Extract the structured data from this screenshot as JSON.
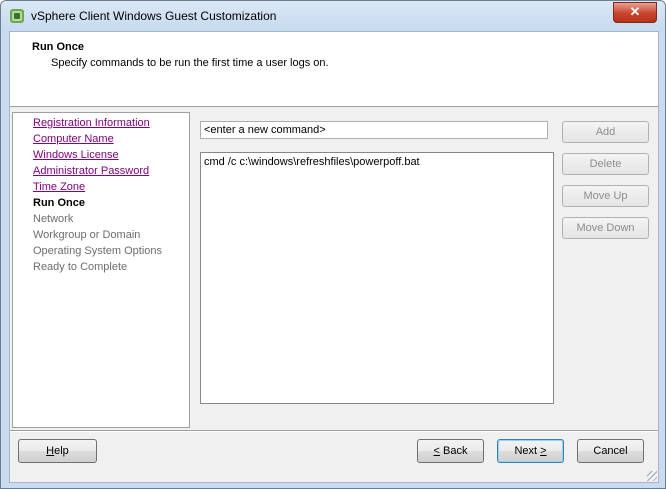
{
  "window": {
    "title": "vSphere Client Windows Guest Customization",
    "close_label": "✕"
  },
  "header": {
    "title": "Run Once",
    "subtitle": "Specify commands to be run the first time a user logs on."
  },
  "nav": {
    "items": [
      {
        "label": "Registration Information",
        "state": "link"
      },
      {
        "label": "Computer Name",
        "state": "link"
      },
      {
        "label": "Windows License",
        "state": "link"
      },
      {
        "label": "Administrator Password",
        "state": "link"
      },
      {
        "label": "Time Zone",
        "state": "link"
      },
      {
        "label": "Run Once",
        "state": "current"
      },
      {
        "label": "Network",
        "state": "disabled"
      },
      {
        "label": "Workgroup or Domain",
        "state": "disabled"
      },
      {
        "label": "Operating System Options",
        "state": "disabled"
      },
      {
        "label": "Ready to Complete",
        "state": "disabled"
      }
    ]
  },
  "command": {
    "new_value": "<enter a new command>",
    "list": [
      "cmd /c c:\\windows\\refreshfiles\\powerpoff.bat"
    ]
  },
  "side_buttons": {
    "add": "Add",
    "delete": "Delete",
    "move_up": "Move Up",
    "move_down": "Move Down"
  },
  "footer": {
    "help_mnemonic": "H",
    "help_rest": "elp",
    "back_mnemonic": "<",
    "back_rest": " Back",
    "next_main": "Next ",
    "next_mnemonic": ">",
    "cancel": "Cancel"
  },
  "colors": {
    "title_bar": "#c6d9ee",
    "visited_link": "#800080",
    "disabled_text": "#6d6d6d",
    "close_button": "#c7432b"
  }
}
